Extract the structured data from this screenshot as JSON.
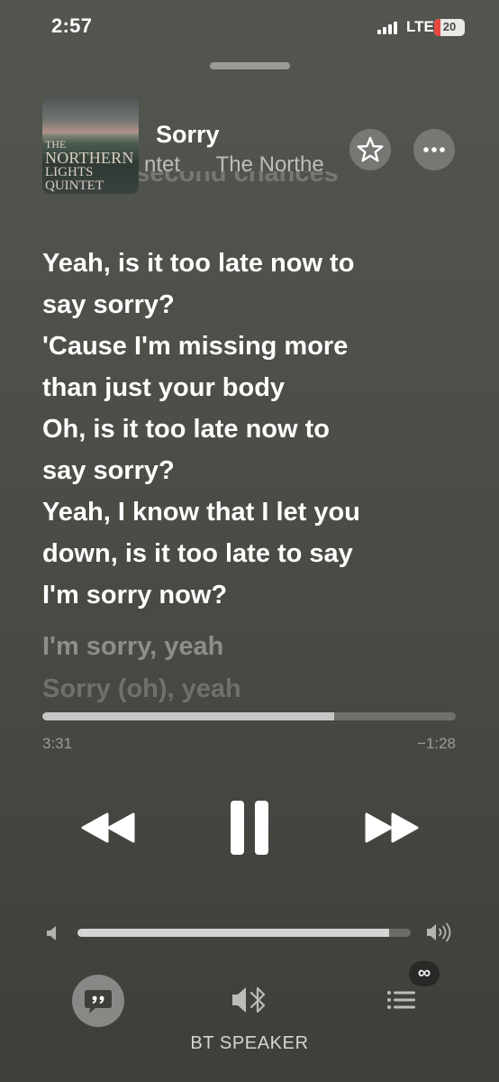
{
  "status_bar": {
    "time": "2:57",
    "network": "LTE",
    "battery": "20",
    "battery_color": "#e5483f"
  },
  "now_playing": {
    "album_art_text": [
      "THE",
      "NORTHERN",
      "LIGHTS QUINTET"
    ],
    "title": "Sorry",
    "artist_marquee": "ntet      The Northe",
    "favorite_icon": "star-icon",
    "more_icon": "ellipsis-icon"
  },
  "lyrics": {
    "previous_line": "shot at second chances",
    "active_lines": [
      "Yeah, is it too late now to",
      "say sorry?",
      "'Cause I'm missing more",
      "than just your body",
      "Oh, is it too late now to",
      "say sorry?",
      "Yeah, I know that I let you",
      "down, is it too late to say",
      "I'm sorry now?"
    ],
    "next_lines": [
      "I'm sorry, yeah",
      "Sorry (oh), yeah"
    ]
  },
  "playback": {
    "elapsed": "3:31",
    "remaining": "−1:28",
    "progress_fraction": 0.705
  },
  "controls": {
    "rewind_icon": "rewind-icon",
    "pause_icon": "pause-icon",
    "forward_icon": "fast-forward-icon"
  },
  "volume": {
    "level_fraction": 0.935
  },
  "bottom_bar": {
    "lyrics_icon": "lyrics-quote-icon",
    "output_icon": "bluetooth-speaker-icon",
    "queue_icon": "queue-list-icon",
    "autoplay_badge": "∞",
    "output_label": "BT SPEAKER"
  }
}
